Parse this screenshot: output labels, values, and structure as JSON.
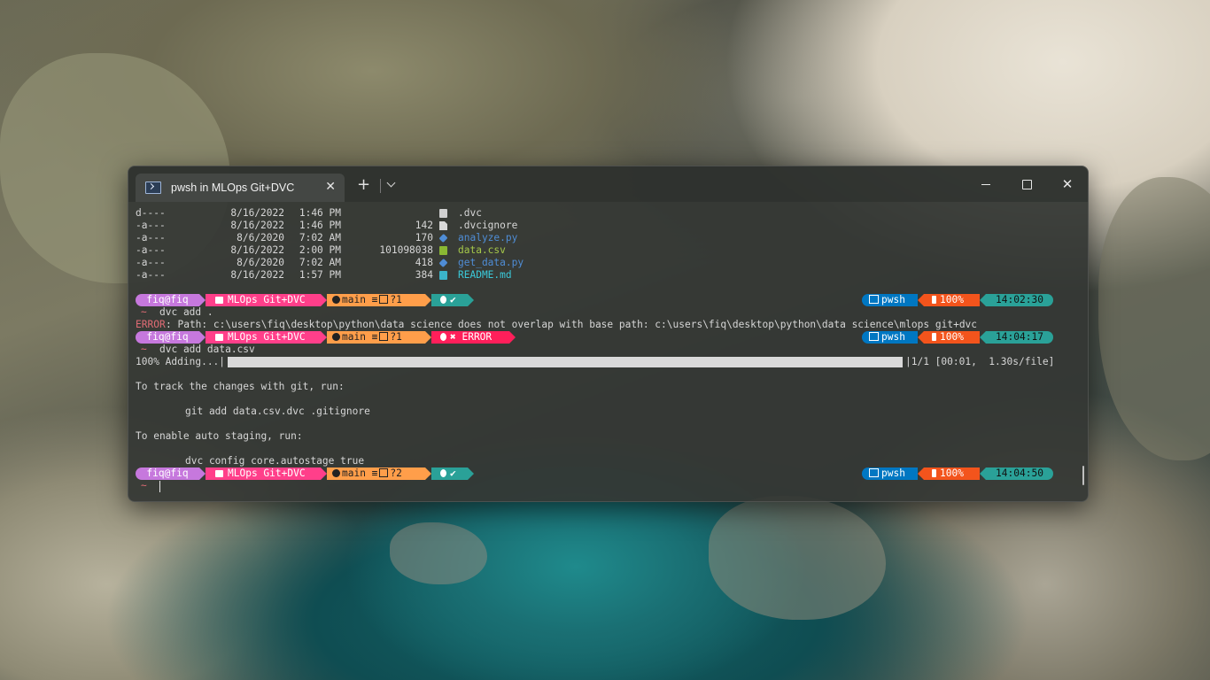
{
  "window": {
    "tab_title": "pwsh in MLOps Git+DVC",
    "tab_close": "✕",
    "new_tab": "+",
    "close_glyph": "✕"
  },
  "listing": [
    {
      "mode": "d----",
      "date": "8/16/2022",
      "time": "1:46 PM",
      "length": "",
      "icon": "folder-icon",
      "name": ".dvc",
      "color": "#d6d6d6"
    },
    {
      "mode": "-a---",
      "date": "8/16/2022",
      "time": "1:46 PM",
      "length": "142",
      "icon": "file-icon",
      "name": ".dvcignore",
      "color": "#d6d6d6"
    },
    {
      "mode": "-a---",
      "date": "8/6/2020",
      "time": "7:02 AM",
      "length": "170",
      "icon": "python-icon",
      "name": "analyze.py",
      "color": "#4f8dd6"
    },
    {
      "mode": "-a---",
      "date": "8/16/2022",
      "time": "2:00 PM",
      "length": "101098038",
      "icon": "csv-icon",
      "name": "data.csv",
      "color": "#a5c84a"
    },
    {
      "mode": "-a---",
      "date": "8/6/2020",
      "time": "7:02 AM",
      "length": "418",
      "icon": "python-icon",
      "name": "get_data.py",
      "color": "#4f8dd6"
    },
    {
      "mode": "-a---",
      "date": "8/16/2022",
      "time": "1:57 PM",
      "length": "384",
      "icon": "markdown-icon",
      "name": "README.md",
      "color": "#3bc9d9"
    }
  ],
  "prompts": [
    {
      "user": "fiq@fiq",
      "folder": "MLOps Git+DVC",
      "git": "main ≡",
      "changes": "?1",
      "status": "✔",
      "shell": "pwsh",
      "battery": "100%",
      "time": "14:02:30"
    },
    {
      "user": "fiq@fiq",
      "folder": "MLOps Git+DVC",
      "git": "main ≡",
      "changes": "?1",
      "status": "✖ ERROR",
      "shell": "pwsh",
      "battery": "100%",
      "time": "14:04:17"
    },
    {
      "user": "fiq@fiq",
      "folder": "MLOps Git+DVC",
      "git": "main ≡",
      "changes": "?2",
      "status": "✔",
      "shell": "pwsh",
      "battery": "100%",
      "time": "14:04:50"
    }
  ],
  "colors": {
    "user_bg": "#c678dd",
    "folder_bg": "#ff3f8a",
    "git_bg": "#ff9e4a",
    "status_ok_bg": "#2aa198",
    "status_err_bg": "#ff1f5a",
    "shell_bg": "#0077c2",
    "battery_bg": "#f3541c",
    "time_bg": "#2aa198"
  },
  "tilde": "~",
  "commands": [
    "dvc add .",
    "dvc add data.csv"
  ],
  "error_label": "ERROR",
  "error_message": ": Path: c:\\users\\fiq\\desktop\\python\\data science does not overlap with base path: c:\\users\\fiq\\desktop\\python\\data science\\mlops git+dvc",
  "progress": {
    "label": "100% Adding...|",
    "fraction": 1.0,
    "tail": "|1/1 [00:01,  1.30s/file]"
  },
  "output": {
    "track_hint": "To track the changes with git, run:",
    "track_cmd": "git add data.csv.dvc .gitignore",
    "stage_hint": "To enable auto staging, run:",
    "stage_cmd": "dvc config core.autostage true"
  }
}
